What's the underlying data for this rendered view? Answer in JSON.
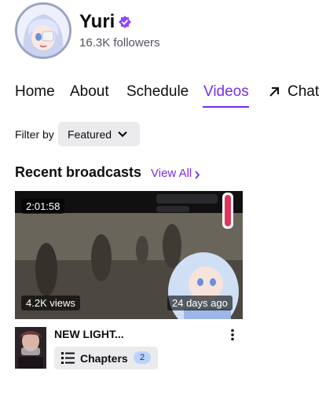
{
  "channel": {
    "name": "Yuri",
    "followers": "16.3K followers",
    "verified_color": "#9147ff"
  },
  "tabs": [
    {
      "label": "Home",
      "active": false
    },
    {
      "label": "About",
      "active": false
    },
    {
      "label": "Schedule",
      "active": false
    },
    {
      "label": "Videos",
      "active": true
    },
    {
      "label": "Chat",
      "active": false,
      "icon": "arrow-up-right-icon"
    }
  ],
  "filter": {
    "label": "Filter by",
    "selected": "Featured"
  },
  "recent": {
    "title": "Recent broadcasts",
    "view_all": "View All"
  },
  "video": {
    "duration": "2:01:58",
    "views": "4.2K views",
    "age": "24 days ago",
    "title": "NEW LIGHT...",
    "chapters_label": "Chapters",
    "chapters_count": "2"
  },
  "colors": {
    "accent": "#772ce8",
    "button_bg": "#ebebee"
  }
}
